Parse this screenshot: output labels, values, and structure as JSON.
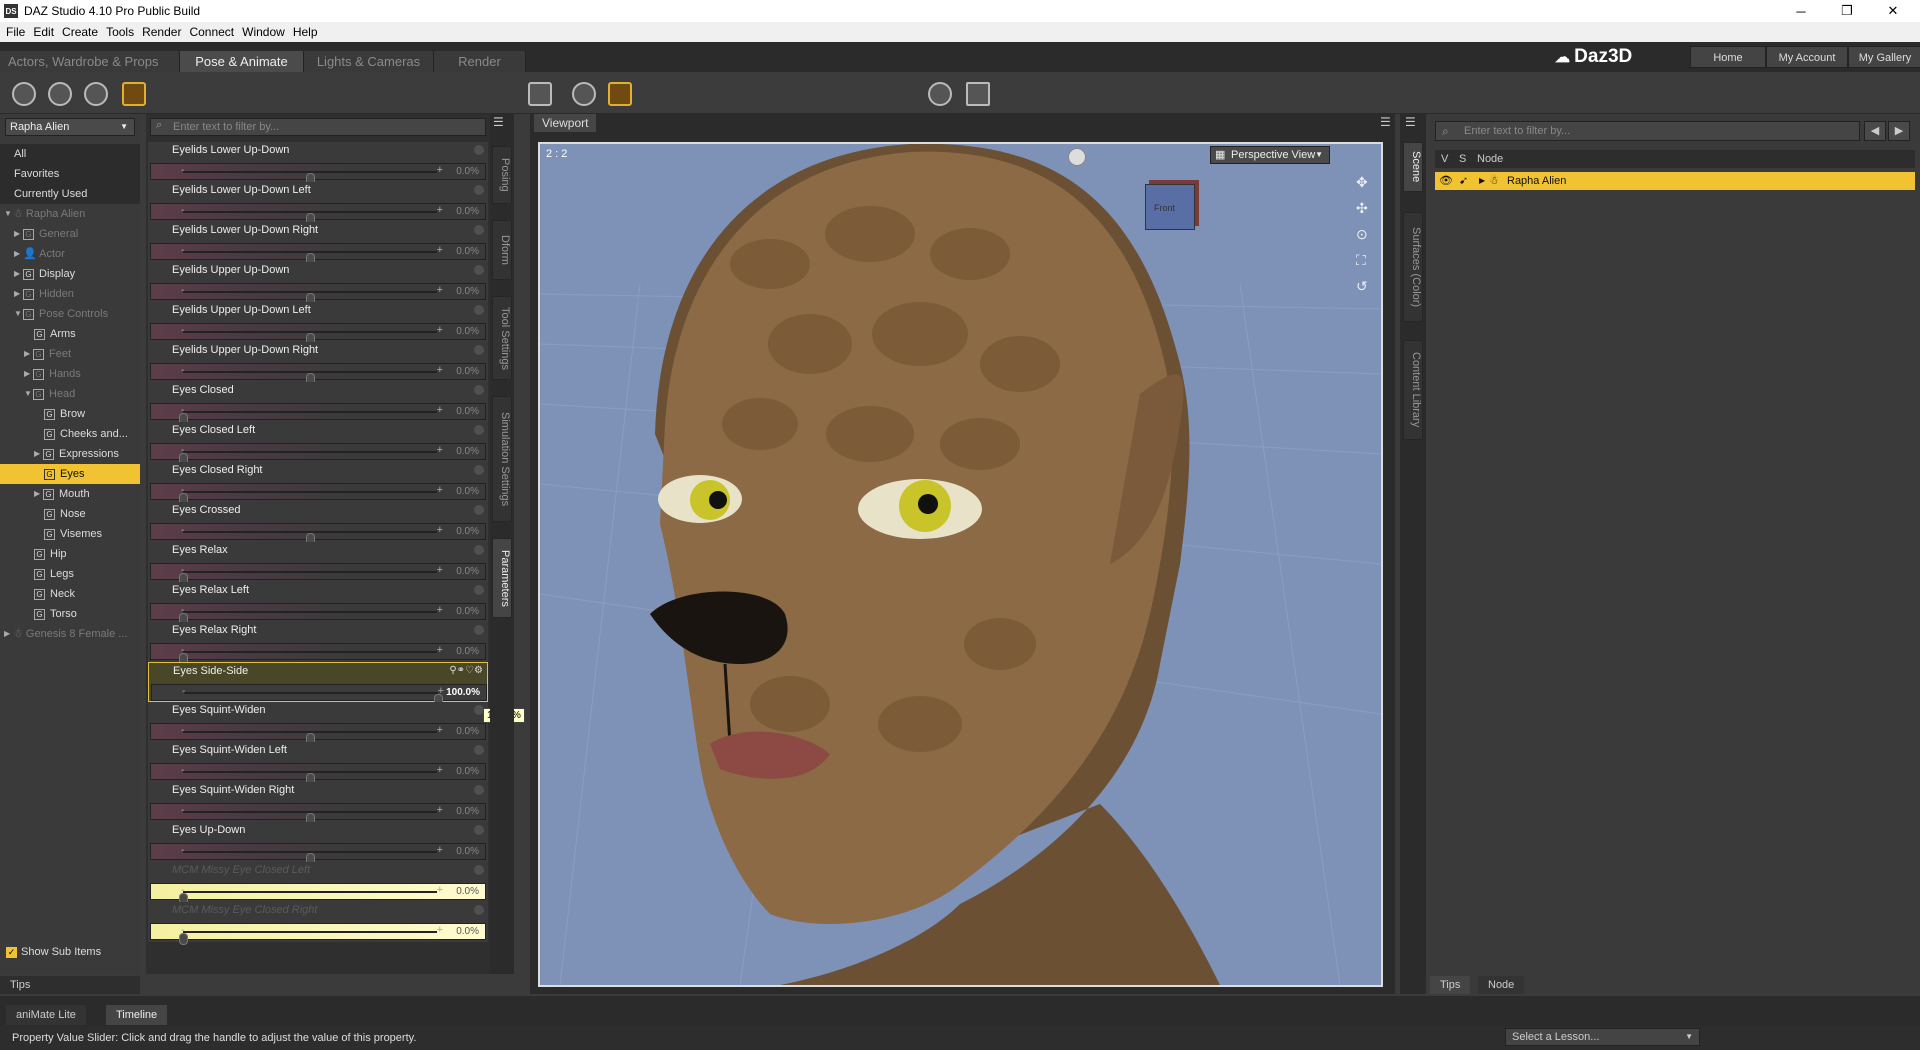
{
  "window": {
    "title": "DAZ Studio 4.10 Pro Public Build",
    "app_icon": "DS",
    "minimize": "─",
    "maximize": "❐",
    "close": "✕"
  },
  "menu": [
    "File",
    "Edit",
    "Create",
    "Tools",
    "Render",
    "Connect",
    "Window",
    "Help"
  ],
  "pane_tabs": [
    "Actors, Wardrobe & Props",
    "Pose & Animate",
    "Lights & Cameras",
    "Render"
  ],
  "header_links": {
    "logo": "Daz3D",
    "home": "Home",
    "account": "My Account",
    "gallery": "My Gallery"
  },
  "left": {
    "figure": "Rapha Alien",
    "categories": [
      "All",
      "Favorites",
      "Currently Used"
    ],
    "tree": [
      {
        "label": "Rapha Alien",
        "dim": true
      },
      {
        "label": "General",
        "dim": true
      },
      {
        "label": "Actor",
        "dim": true
      },
      {
        "label": "Display",
        "dim": false
      },
      {
        "label": "Hidden",
        "dim": true
      },
      {
        "label": "Pose Controls",
        "dim": true
      },
      {
        "label": "Arms",
        "dim": false
      },
      {
        "label": "Feet",
        "dim": true
      },
      {
        "label": "Hands",
        "dim": true
      },
      {
        "label": "Head",
        "dim": true
      },
      {
        "label": "Brow",
        "dim": false
      },
      {
        "label": "Cheeks and...",
        "dim": false
      },
      {
        "label": "Expressions",
        "dim": false
      },
      {
        "label": "Eyes",
        "dim": false,
        "selected": true
      },
      {
        "label": "Mouth",
        "dim": false
      },
      {
        "label": "Nose",
        "dim": false
      },
      {
        "label": "Visemes",
        "dim": false
      },
      {
        "label": "Hip",
        "dim": false
      },
      {
        "label": "Legs",
        "dim": false
      },
      {
        "label": "Neck",
        "dim": false
      },
      {
        "label": "Torso",
        "dim": false
      },
      {
        "label": "Genesis 8 Female ...",
        "dim": true
      }
    ],
    "show_sub_items": "Show Sub Items",
    "tips": "Tips"
  },
  "params": {
    "filter_placeholder": "Enter text to filter by...",
    "rows": [
      {
        "label": "Eyelids Lower Up-Down",
        "value": "0.0%",
        "pos": 0.5
      },
      {
        "label": "Eyelids Lower Up-Down Left",
        "value": "0.0%",
        "pos": 0.5
      },
      {
        "label": "Eyelids Lower Up-Down Right",
        "value": "0.0%",
        "pos": 0.5
      },
      {
        "label": "Eyelids Upper Up-Down",
        "value": "0.0%",
        "pos": 0.5
      },
      {
        "label": "Eyelids Upper Up-Down Left",
        "value": "0.0%",
        "pos": 0.5
      },
      {
        "label": "Eyelids Upper Up-Down Right",
        "value": "0.0%",
        "pos": 0.5
      },
      {
        "label": "Eyes Closed",
        "value": "0.0%",
        "pos": 0.0
      },
      {
        "label": "Eyes Closed Left",
        "value": "0.0%",
        "pos": 0.0
      },
      {
        "label": "Eyes Closed Right",
        "value": "0.0%",
        "pos": 0.0
      },
      {
        "label": "Eyes Crossed",
        "value": "0.0%",
        "pos": 0.5
      },
      {
        "label": "Eyes Relax",
        "value": "0.0%",
        "pos": 0.0
      },
      {
        "label": "Eyes Relax Left",
        "value": "0.0%",
        "pos": 0.0
      },
      {
        "label": "Eyes Relax Right",
        "value": "0.0%",
        "pos": 0.0
      },
      {
        "label": "Eyes Side-Side",
        "value": "100.0%",
        "pos": 1.0,
        "active": true
      },
      {
        "label": "Eyes Squint-Widen",
        "value": "0.0%",
        "pos": 0.5
      },
      {
        "label": "Eyes Squint-Widen Left",
        "value": "0.0%",
        "pos": 0.5
      },
      {
        "label": "Eyes Squint-Widen Right",
        "value": "0.0%",
        "pos": 0.5
      },
      {
        "label": "Eyes Up-Down",
        "value": "0.0%",
        "pos": 0.5
      },
      {
        "label": "MCM Missy Eye Closed Left",
        "value": "0.0%",
        "pos": 0.0,
        "yellow": true
      },
      {
        "label": "MCM Missy Eye Closed Right",
        "value": "0.0%",
        "pos": 0.0,
        "yellow": true
      }
    ],
    "tooltip": "100.0%",
    "minus": "-",
    "plus": "+"
  },
  "side_tabs_left": [
    "Posing",
    "Dform",
    "Tool Settings",
    "Simulation Settings",
    "Parameters"
  ],
  "viewport": {
    "tab": "Viewport",
    "ratio": "2 : 2",
    "view": "Perspective View",
    "cube_label": "Front"
  },
  "side_tabs_right": [
    "Scene",
    "Surfaces (Color)",
    "Content Library"
  ],
  "scene": {
    "filter_placeholder": "Enter text to filter by...",
    "cols": {
      "v": "V",
      "s": "S",
      "node": "Node"
    },
    "node": "Rapha Alien",
    "bottom_tabs": [
      "Tips",
      "Node"
    ]
  },
  "bottom": {
    "tabs": [
      "aniMate Lite",
      "Timeline"
    ],
    "status": "Property Value Slider: Click and drag the handle to adjust the value of this property.",
    "lesson": "Select a Lesson..."
  },
  "colors": {
    "accent": "#f1c232",
    "viewport_bg": "#7e92b8"
  }
}
